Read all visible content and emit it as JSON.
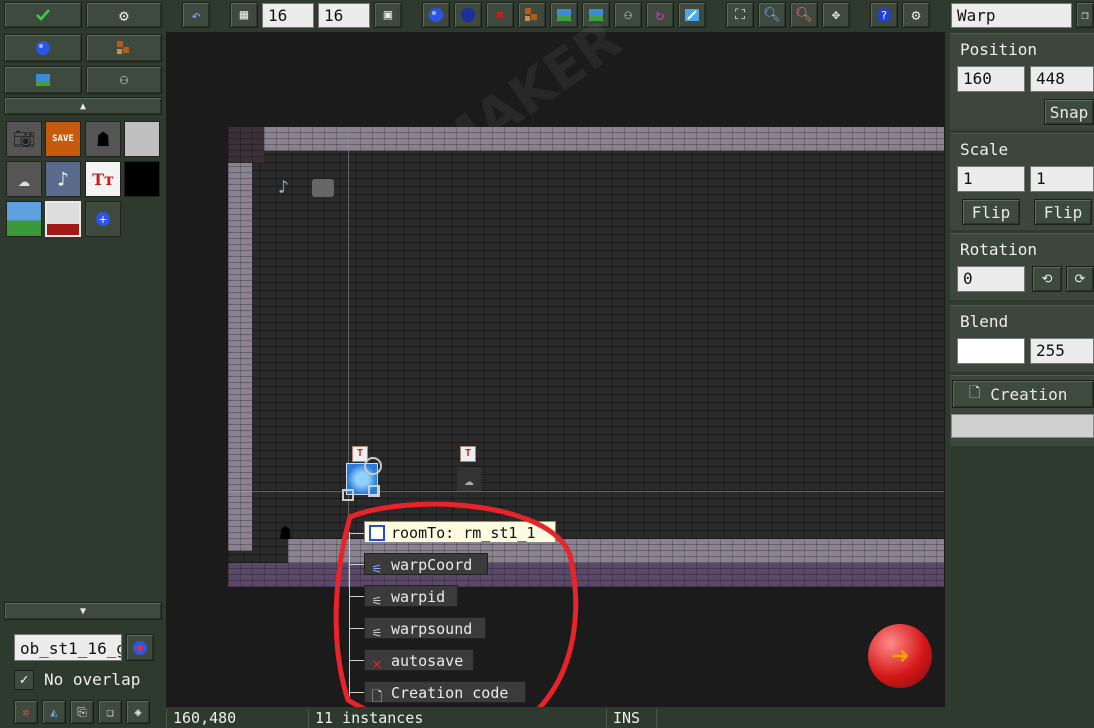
{
  "layers": {
    "grid_w": "16",
    "grid_h": "16"
  },
  "left_panel": {
    "object_name": "ob_st1_16_g",
    "no_overlap_label": "No overlap",
    "no_overlap_checked": true
  },
  "right_panel": {
    "title_field": "Warp",
    "position": {
      "label": "Position",
      "x": "160",
      "y": "448",
      "snap": "Snap"
    },
    "scale": {
      "label": "Scale",
      "x": "1",
      "y": "1",
      "flip_x": "Flip",
      "flip_y": "Flip"
    },
    "rotation": {
      "label": "Rotation",
      "value": "0"
    },
    "blend": {
      "label": "Blend",
      "alpha": "255"
    },
    "creation_button": "Creation"
  },
  "room": {
    "watermark": "GAME MAKER"
  },
  "popup": {
    "items": [
      {
        "label": "roomTo: rm_st1_1",
        "icon": "room-icon",
        "highlight": true
      },
      {
        "label": "warpCoord",
        "icon": "variable-icon",
        "highlight": false
      },
      {
        "label": "warpid",
        "icon": "variable-icon",
        "highlight": false
      },
      {
        "label": "warpsound",
        "icon": "variable-icon",
        "highlight": false
      },
      {
        "label": "autosave",
        "icon": "cross-icon",
        "highlight": false
      },
      {
        "label": "Creation code",
        "icon": "page-icon",
        "highlight": false
      }
    ]
  },
  "status": {
    "coords": "160,480",
    "instances": "11 instances",
    "mode": "INS"
  },
  "colors": {
    "panel": "#2d3a2d",
    "annotation": "#e8232a"
  }
}
